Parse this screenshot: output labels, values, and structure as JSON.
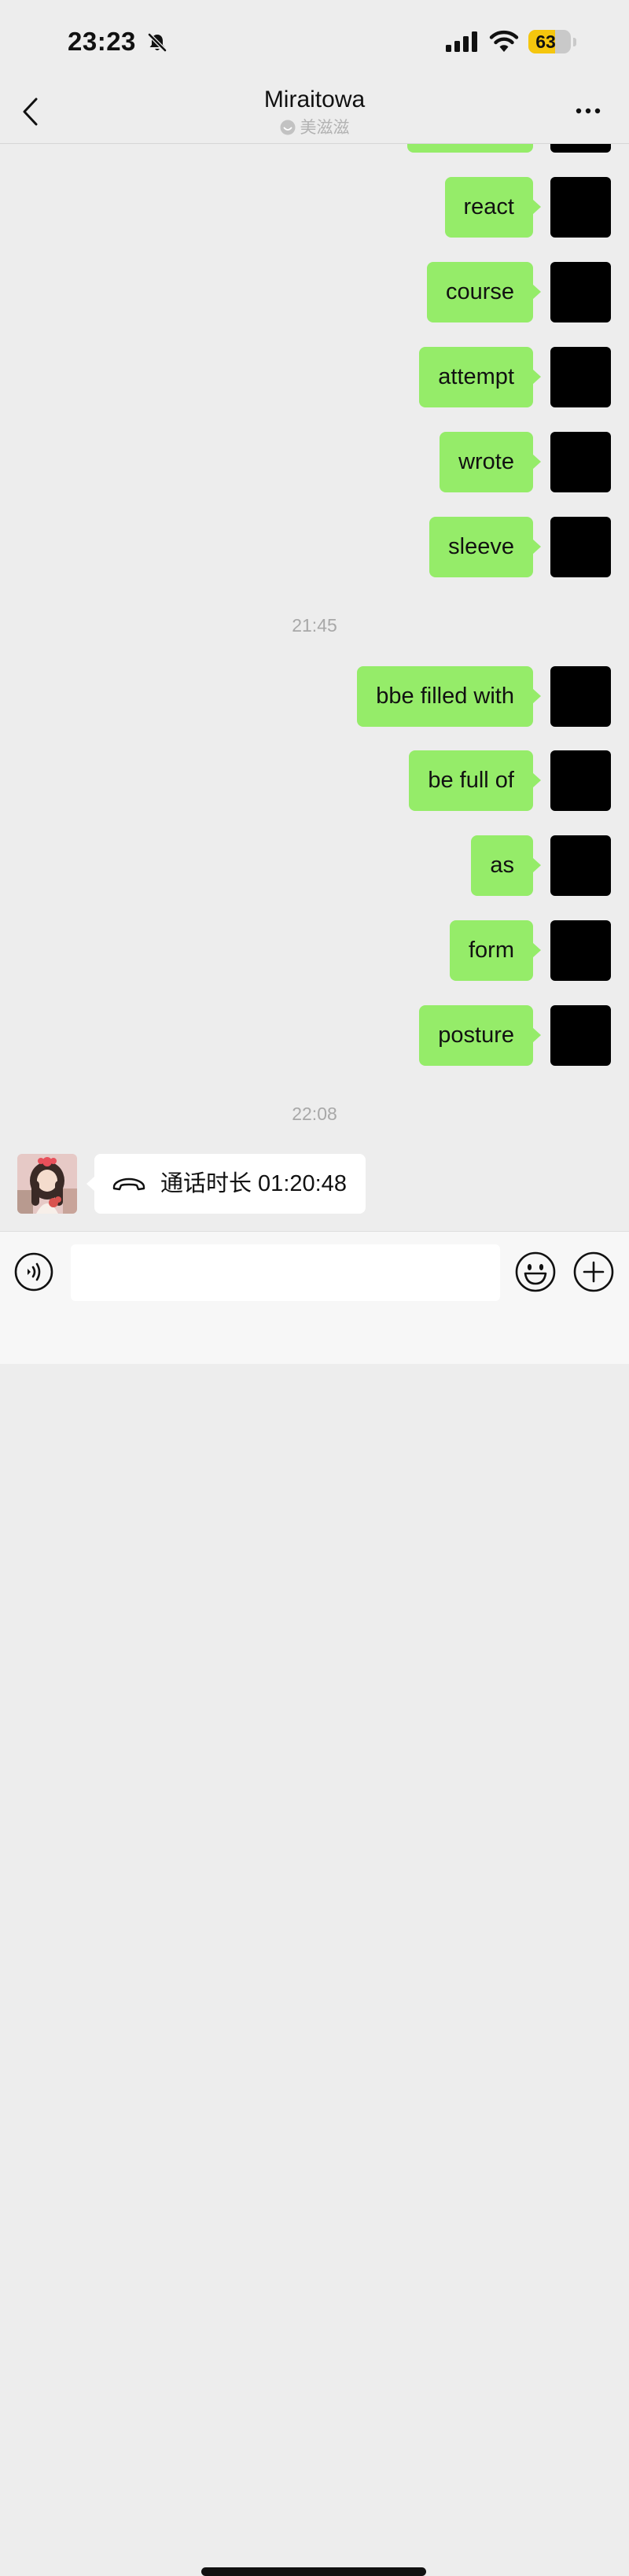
{
  "status_bar": {
    "time": "23:23",
    "battery_level": "63",
    "battery_fraction": 0.63,
    "icons": [
      "bell-muted-icon",
      "signal-icon",
      "wifi-icon",
      "battery-icon"
    ]
  },
  "header": {
    "title": "Miraitowa",
    "subtitle": "美滋滋",
    "icons": [
      "back-icon",
      "more-icon"
    ]
  },
  "messages": {
    "group1": [
      "react",
      "course",
      "attempt",
      "wrote",
      "sleeve"
    ],
    "time1": "21:45",
    "group2": [
      "bbe filled with",
      "be full of",
      "as",
      "form",
      "posture"
    ],
    "time2": "22:08",
    "call": {
      "label": "通话时长 01:20:48",
      "icon": "hangup-phone-icon"
    }
  },
  "input_bar": {
    "value": "",
    "placeholder": "",
    "icons": [
      "voice-icon",
      "emoji-icon",
      "plus-icon"
    ]
  },
  "colors": {
    "background": "#ededed",
    "self_bubble": "#95ec69",
    "other_bubble": "#ffffff",
    "battery": "#f5c60e"
  }
}
